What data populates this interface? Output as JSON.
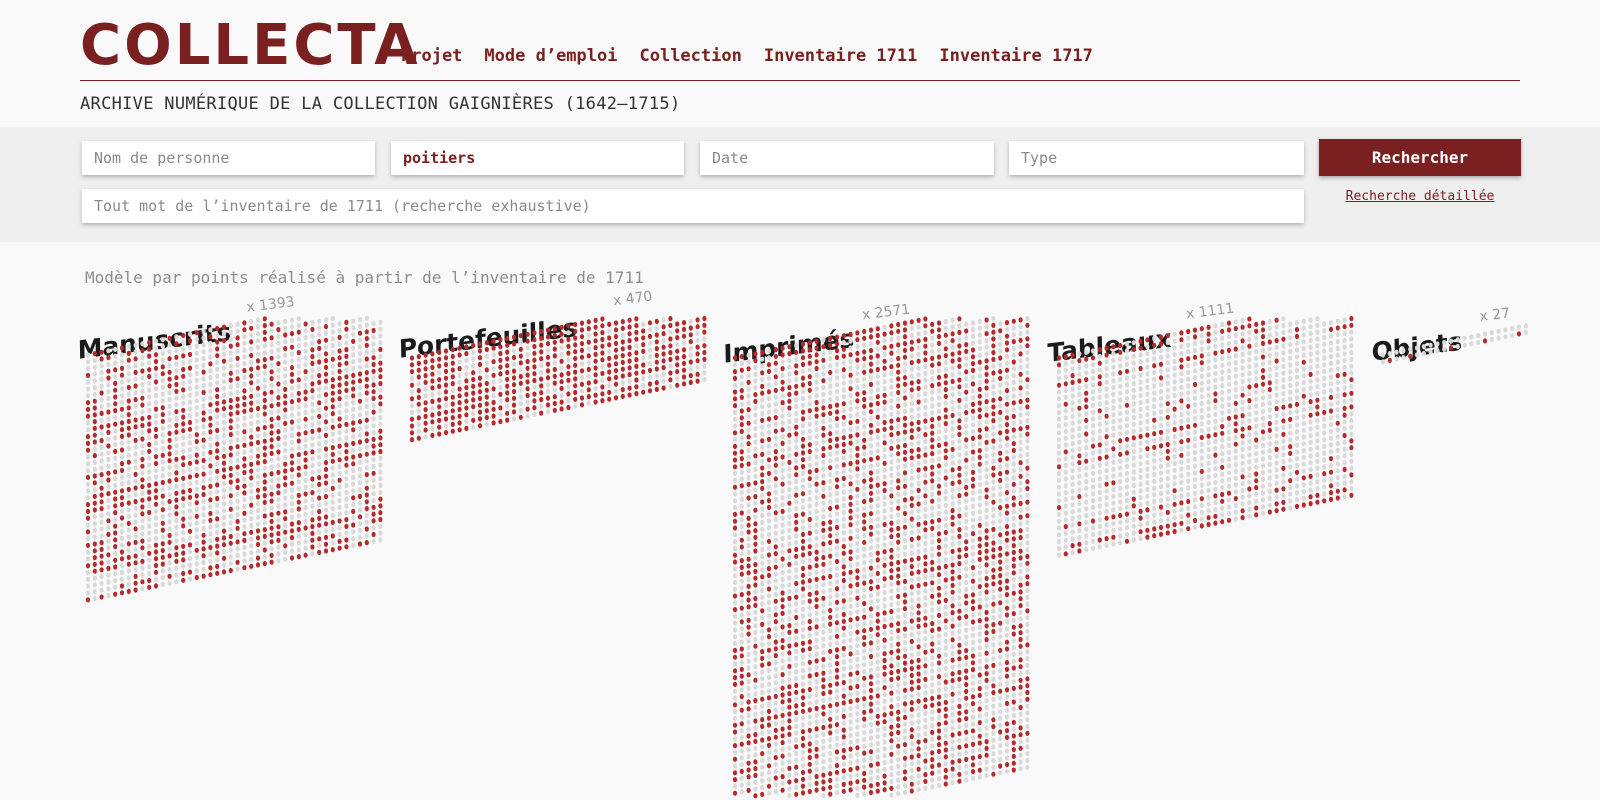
{
  "header": {
    "logo": "COLLECTA",
    "nav": [
      {
        "label": "Projet"
      },
      {
        "label": "Mode d’emploi"
      },
      {
        "label": "Collection"
      },
      {
        "label": "Inventaire 1711"
      },
      {
        "label": "Inventaire 1717"
      }
    ],
    "subtitle": "ARCHIVE NUMÉRIQUE DE LA COLLECTION GAIGNIÈRES (1642–1715)"
  },
  "search": {
    "person_placeholder": "Nom de personne",
    "place_value": "poitiers",
    "date_placeholder": "Date",
    "type_placeholder": "Type",
    "fulltext_placeholder": "Tout mot de l’inventaire de 1711 (recherche exhaustive)",
    "submit_label": "Rechercher",
    "advanced_label": "Recherche détaillée"
  },
  "visualization": {
    "caption": "Modèle par points réalisé à partir de l’inventaire de 1711",
    "categories": [
      {
        "name": "Manuscrits",
        "count_label": "x 1393",
        "total": 1393
      },
      {
        "name": "Portefeuilles",
        "count_label": "x 470",
        "total": 470
      },
      {
        "name": "Imprimés",
        "count_label": "x 2571",
        "total": 2571
      },
      {
        "name": "Tableaux",
        "count_label": "x 1111",
        "total": 1111
      },
      {
        "name": "Objets",
        "count_label": "x 27",
        "total": 27
      }
    ],
    "colors": {
      "match": "#b52a2a",
      "other": "#d9d9d9",
      "accent": "#7a2020"
    }
  }
}
